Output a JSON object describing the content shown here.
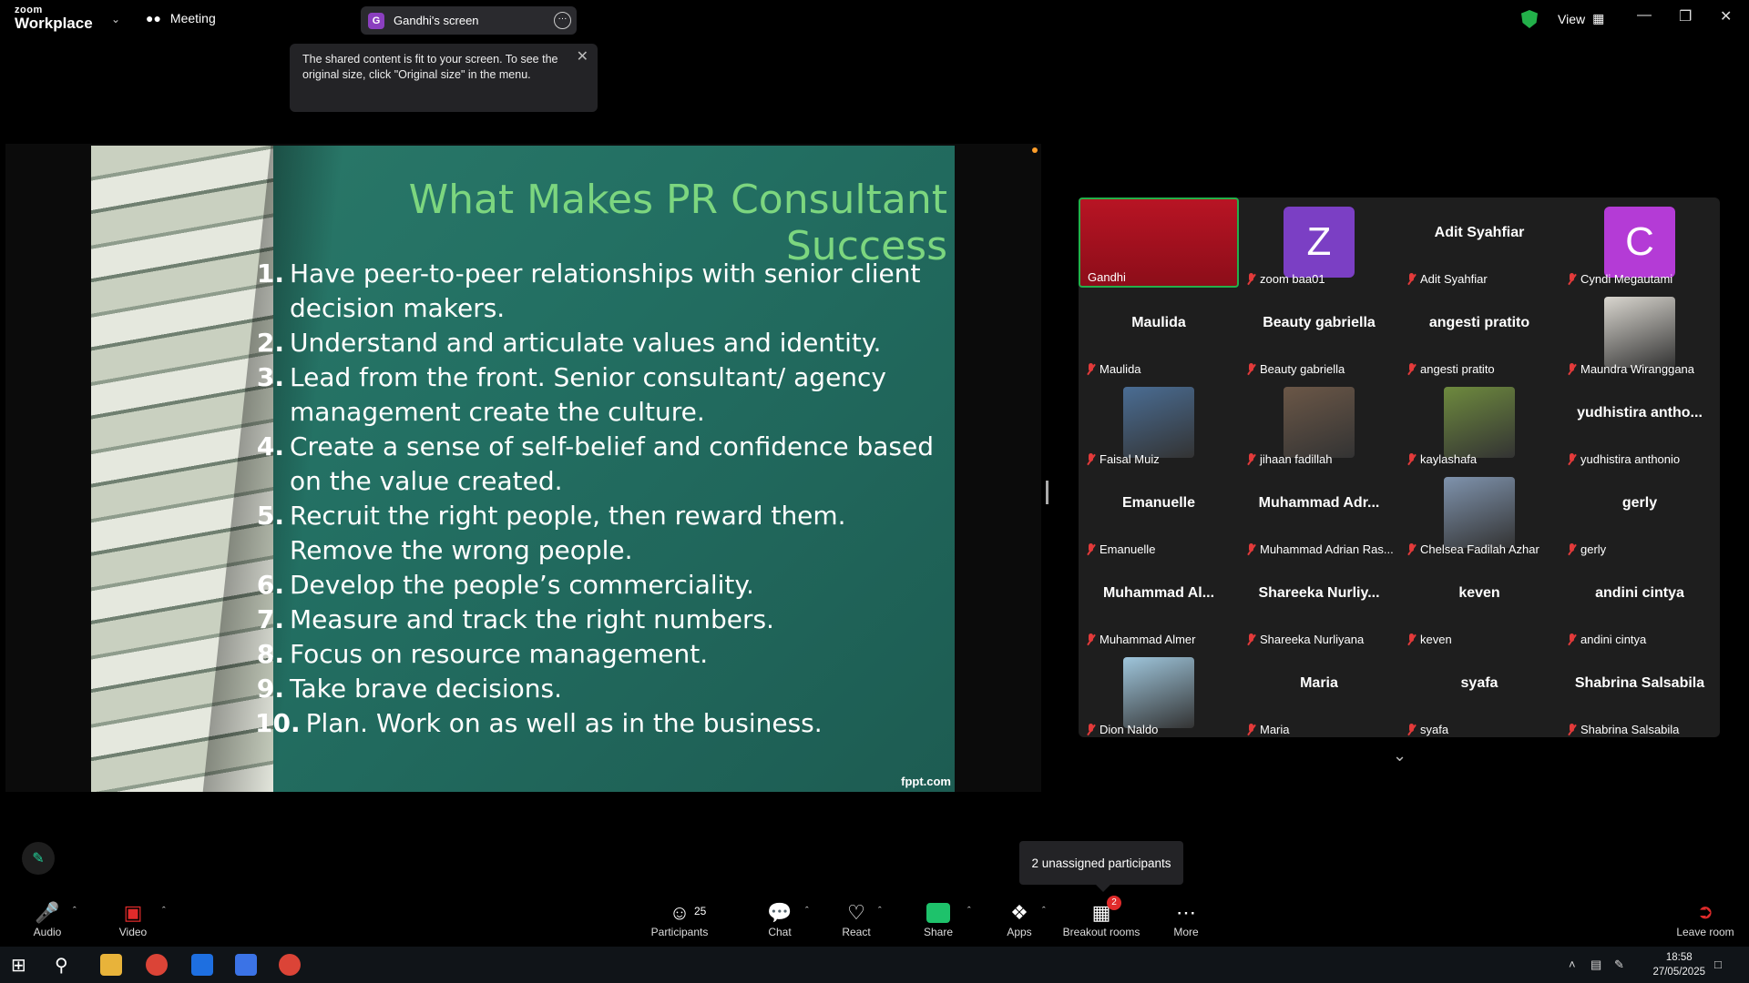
{
  "app": {
    "logo_top": "zoom",
    "logo_bottom": "Workplace",
    "meeting_label": "Meeting",
    "share_pill": {
      "initial": "G",
      "label": "Gandhi's screen"
    },
    "tooltip": "The shared content is fit to your screen. To see the original size, click \"Original size\" in the menu.",
    "view_label": "View"
  },
  "slide": {
    "title": "What Makes PR Consultant Success",
    "items": [
      {
        "num": "1.",
        "text": "Have peer-to-peer relationships with senior client decision makers."
      },
      {
        "num": "2.",
        "text": "Understand and articulate values and identity."
      },
      {
        "num": "3.",
        "text": "Lead from the front. Senior consultant/ agency management create the culture."
      },
      {
        "num": "4.",
        "text": "Create a sense of self-belief and confidence based on the value created."
      },
      {
        "num": "5.",
        "text": "Recruit the right people, then reward them. Remove the wrong people."
      },
      {
        "num": "6.",
        "text": "Develop the people’s commerciality."
      },
      {
        "num": "7.",
        "text": "Measure and track the right numbers."
      },
      {
        "num": "8.",
        "text": "Focus on resource management."
      },
      {
        "num": "9.",
        "text": "Take brave decisions."
      },
      {
        "num": "10.",
        "text": "Plan. Work on as well as in the business."
      }
    ],
    "footer": "fppt.com"
  },
  "gallery": [
    {
      "name": "Gandhi",
      "kind": "active"
    },
    {
      "name": "zoom baa01",
      "kind": "letter",
      "letter": "Z",
      "color": "#7b3fc4"
    },
    {
      "name": "Adit Syahfiar",
      "kind": "text",
      "big": "Adit Syahfiar"
    },
    {
      "name": "Cyndi Megautami",
      "kind": "letter",
      "letter": "C",
      "color": "#b43bd6"
    },
    {
      "name": "Maulida",
      "kind": "text",
      "big": "Maulida"
    },
    {
      "name": "Beauty gabriella",
      "kind": "text",
      "big": "Beauty gabriella"
    },
    {
      "name": "angesti pratito",
      "kind": "text",
      "big": "angesti pratito"
    },
    {
      "name": "Maundra Wiranggana",
      "kind": "photo",
      "color": "#d9d6cf"
    },
    {
      "name": "Faisal Muiz",
      "kind": "photo",
      "color": "#4a6d94"
    },
    {
      "name": "jihaan fadillah",
      "kind": "photo",
      "color": "#6b5747"
    },
    {
      "name": "kaylashafa",
      "kind": "photo",
      "color": "#6e8a3e"
    },
    {
      "name": "yudhistira anthonio",
      "kind": "text",
      "big": "yudhistira antho..."
    },
    {
      "name": "Emanuelle",
      "kind": "text",
      "big": "Emanuelle"
    },
    {
      "name": "Muhammad Adrian Ras...",
      "kind": "text",
      "big": "Muhammad Adr..."
    },
    {
      "name": "Chelsea Fadilah Azhar",
      "kind": "photo",
      "color": "#7f93ad"
    },
    {
      "name": "gerly",
      "kind": "text",
      "big": "gerly"
    },
    {
      "name": "Muhammad Almer",
      "kind": "text",
      "big": "Muhammad Al..."
    },
    {
      "name": "Shareeka Nurliyana",
      "kind": "text",
      "big": "Shareeka Nurliy..."
    },
    {
      "name": "keven",
      "kind": "text",
      "big": "keven"
    },
    {
      "name": "andini cintya",
      "kind": "text",
      "big": "andini cintya"
    },
    {
      "name": "Dion Naldo",
      "kind": "photo",
      "color": "#9fc6dc"
    },
    {
      "name": "Maria",
      "kind": "text",
      "big": "Maria"
    },
    {
      "name": "syafa",
      "kind": "text",
      "big": "syafa"
    },
    {
      "name": "Shabrina Salsabila",
      "kind": "text",
      "big": "Shabrina Salsabila"
    }
  ],
  "unassigned": "2 unassigned participants",
  "toolbar": {
    "audio": "Audio",
    "video": "Video",
    "participants": "Participants",
    "participants_count": "25",
    "chat": "Chat",
    "react": "React",
    "share": "Share",
    "apps": "Apps",
    "breakout": "Breakout rooms",
    "breakout_badge": "2",
    "more": "More",
    "leave": "Leave room"
  },
  "taskbar": {
    "time": "18:58",
    "date": "27/05/2025"
  }
}
